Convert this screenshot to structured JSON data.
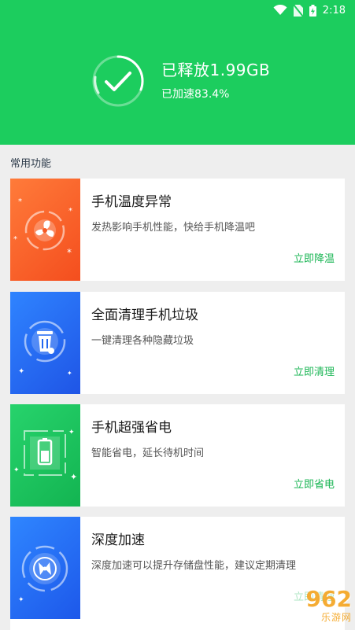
{
  "status_bar": {
    "time": "2:18",
    "icons": [
      "wifi-icon",
      "no-sim-icon",
      "battery-charging-icon"
    ]
  },
  "result": {
    "title": "已释放1.99GB",
    "subtitle": "已加速83.4%"
  },
  "section_title": "常用功能",
  "cards": [
    {
      "title": "手机温度异常",
      "desc": "发热影响手机性能，快给手机降温吧",
      "action": "立即降温",
      "icon": "fan-icon",
      "color": "#f65a25"
    },
    {
      "title": "全面清理手机垃圾",
      "desc": "一键清理各种隐藏垃圾",
      "action": "立即清理",
      "icon": "trash-icon",
      "color": "#2368f0"
    },
    {
      "title": "手机超强省电",
      "desc": "智能省电，延长待机时间",
      "action": "立即省电",
      "icon": "battery-icon",
      "color": "#1cc35f"
    },
    {
      "title": "深度加速",
      "desc": "深度加速可以提升存储盘性能，建议定期清理",
      "action": "立即清理",
      "icon": "disk-icon",
      "color": "#2368f0"
    }
  ],
  "watermark": {
    "brand": "962",
    "sub": "乐游网"
  },
  "colors": {
    "accent": "#1ccd5e",
    "action_text": "#1bb655"
  }
}
